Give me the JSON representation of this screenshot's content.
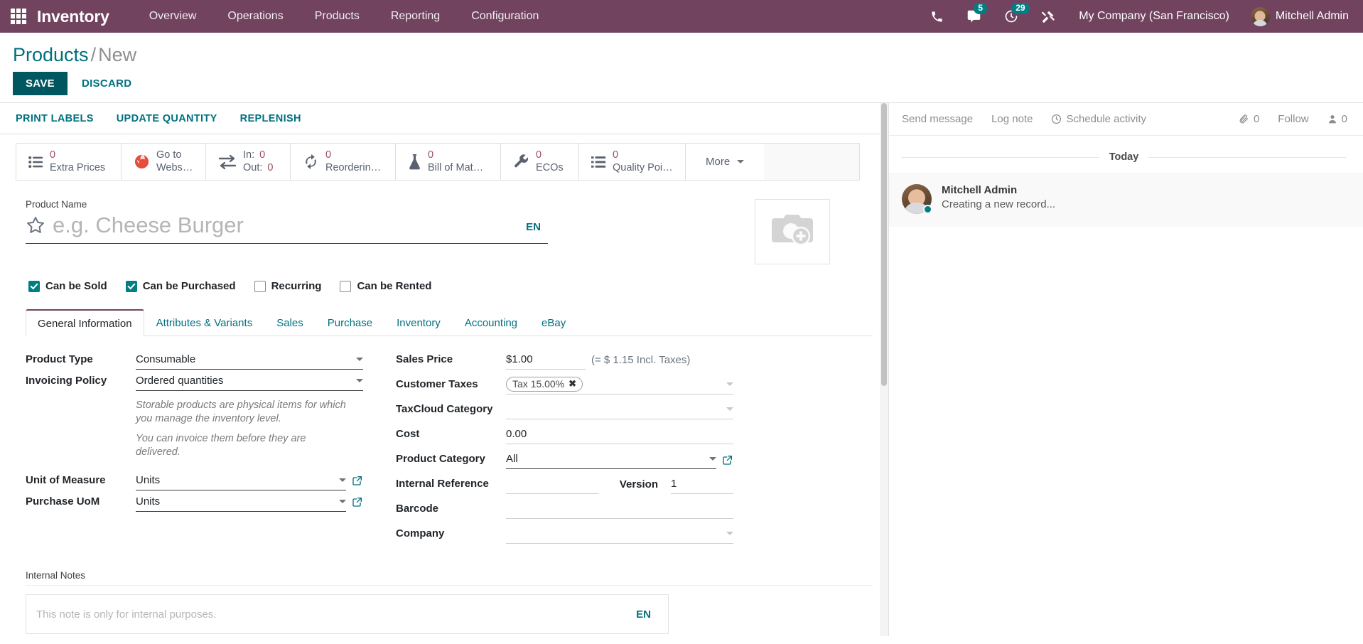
{
  "navbar": {
    "apps_icon": "apps-grid-icon",
    "brand": "Inventory",
    "menu": [
      {
        "label": "Overview"
      },
      {
        "label": "Operations"
      },
      {
        "label": "Products"
      },
      {
        "label": "Reporting"
      },
      {
        "label": "Configuration"
      }
    ],
    "icons": [
      {
        "name": "phone-icon",
        "badge": ""
      },
      {
        "name": "messages-icon",
        "badge": "5"
      },
      {
        "name": "activities-clock-icon",
        "badge": "29"
      },
      {
        "name": "debug-tools-icon",
        "badge": ""
      }
    ],
    "company": "My Company (San Francisco)",
    "user": "Mitchell Admin",
    "bg_color": "#71435f",
    "badge_color": "#017e84"
  },
  "breadcrumb": {
    "root": "Products",
    "separator": "/",
    "current": "New"
  },
  "record_actions": {
    "save_label": "SAVE",
    "discard_label": "DISCARD",
    "save_bg": "#00575f",
    "link_color": "#00707f"
  },
  "sheet_actions": [
    {
      "label": "PRINT LABELS"
    },
    {
      "label": "UPDATE QUANTITY"
    },
    {
      "label": "REPLENISH"
    }
  ],
  "stat_buttons": [
    {
      "icon": "list-icon",
      "value": "0",
      "label": "Extra Prices",
      "type": "count"
    },
    {
      "icon": "globe-icon",
      "value": "",
      "label": "Go to\nWebsite",
      "type": "link",
      "line1": "Go to",
      "line2": "Website"
    },
    {
      "icon": "arrows-in-out-icon",
      "type": "inout",
      "in_key": "In:",
      "in_value": "0",
      "out_key": "Out:",
      "out_value": "0"
    },
    {
      "icon": "refresh-icon",
      "value": "0",
      "label": "Reordering…",
      "type": "count"
    },
    {
      "icon": "flask-icon",
      "value": "0",
      "label": "Bill of Mat…",
      "type": "count"
    },
    {
      "icon": "wrench-icon",
      "value": "0",
      "label": "ECOs",
      "type": "count"
    },
    {
      "icon": "list-icon",
      "value": "0",
      "label": "Quality Poi…",
      "type": "count"
    }
  ],
  "stat_more": {
    "label": "More",
    "icon": "chevron-down-icon"
  },
  "product": {
    "name_label": "Product Name",
    "name_value": "",
    "name_placeholder": "e.g. Cheese Burger",
    "lang_tag": "EN",
    "favorite_icon": "star-outline-icon",
    "image_placeholder_icon": "camera-add-icon"
  },
  "checkboxes": [
    {
      "label": "Can be Sold",
      "checked": true
    },
    {
      "label": "Can be Purchased",
      "checked": true
    },
    {
      "label": "Recurring",
      "checked": false
    },
    {
      "label": "Can be Rented",
      "checked": false
    }
  ],
  "tabs": [
    {
      "label": "General Information",
      "active": true
    },
    {
      "label": "Attributes & Variants",
      "active": false
    },
    {
      "label": "Sales",
      "active": false
    },
    {
      "label": "Purchase",
      "active": false
    },
    {
      "label": "Inventory",
      "active": false
    },
    {
      "label": "Accounting",
      "active": false
    },
    {
      "label": "eBay",
      "active": false
    }
  ],
  "form": {
    "left": {
      "product_type": {
        "label": "Product Type",
        "value": "Consumable"
      },
      "invoicing_policy": {
        "label": "Invoicing Policy",
        "value": "Ordered quantities"
      },
      "hint_1": "Storable products are physical items for which you manage the inventory level.",
      "hint_2": "You can invoice them before they are delivered.",
      "uom": {
        "label": "Unit of Measure",
        "value": "Units"
      },
      "purchase_uom": {
        "label": "Purchase UoM",
        "value": "Units"
      }
    },
    "right": {
      "sales_price": {
        "label": "Sales Price",
        "value": "$1.00",
        "extra": "(= $ 1.15 Incl. Taxes)"
      },
      "customer_taxes": {
        "label": "Customer Taxes",
        "tag": "Tax 15.00%",
        "tag_remove": "✖"
      },
      "taxcloud_category": {
        "label": "TaxCloud Category",
        "value": ""
      },
      "cost": {
        "label": "Cost",
        "value": "0.00"
      },
      "product_category": {
        "label": "Product Category",
        "value": "All"
      },
      "internal_reference": {
        "label": "Internal Reference",
        "value": ""
      },
      "version": {
        "label": "Version",
        "value": "1"
      },
      "barcode": {
        "label": "Barcode",
        "value": ""
      },
      "company": {
        "label": "Company",
        "value": ""
      }
    }
  },
  "notes": {
    "label": "Internal Notes",
    "placeholder": "This note is only for internal purposes.",
    "value": "",
    "lang_tag": "EN"
  },
  "chatter": {
    "send_message": "Send message",
    "log_note": "Log note",
    "schedule_activity": "Schedule activity",
    "schedule_icon": "clock-icon",
    "attachment_icon": "paperclip-icon",
    "attachment_count": "0",
    "follow_label": "Follow",
    "followers_icon": "user-icon",
    "followers_count": "0",
    "day_label": "Today",
    "messages": [
      {
        "author": "Mitchell Admin",
        "body": "Creating a new record...",
        "online": true
      }
    ]
  }
}
